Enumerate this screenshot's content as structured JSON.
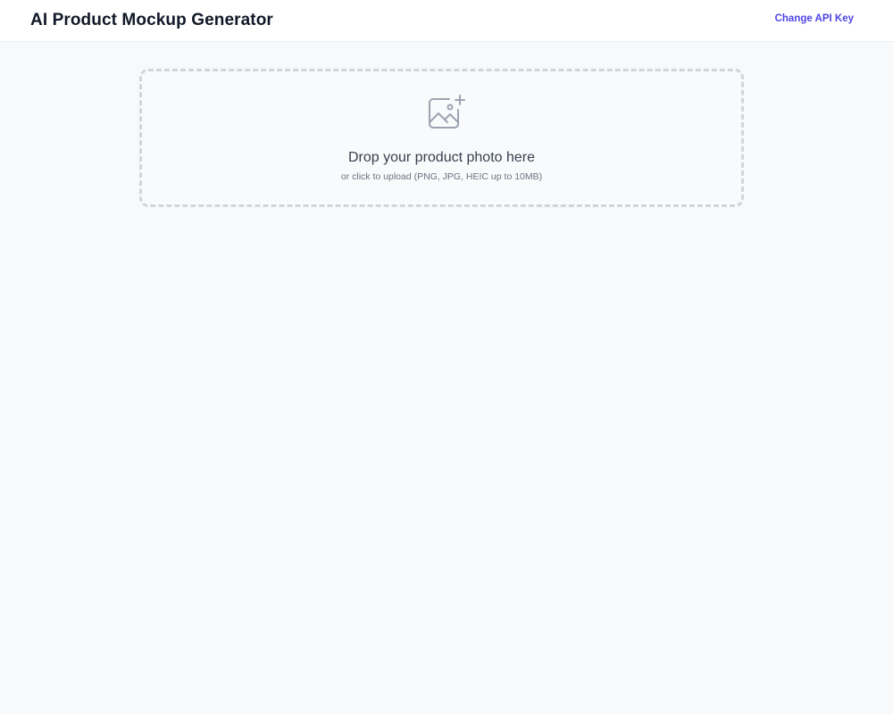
{
  "header": {
    "title": "AI Product Mockup Generator",
    "api_key_link": "Change API Key"
  },
  "upload": {
    "icon": "image-add-icon",
    "title": "Drop your product photo here",
    "subtitle": "or click to upload (PNG, JPG, HEIC up to 10MB)"
  },
  "colors": {
    "accent": "#4f46e5",
    "background": "#f8f9fb",
    "dropzone_border": "#d1d5db"
  }
}
